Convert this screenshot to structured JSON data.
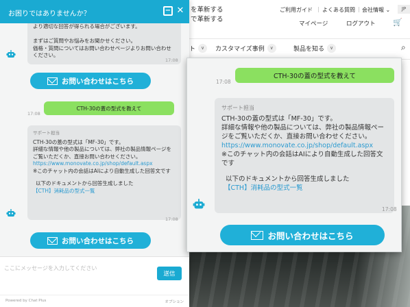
{
  "site": {
    "tagline_line1": "を革新する",
    "tagline_line2": "で革新する",
    "util_links": [
      "ご利用ガイド",
      "よくある質問",
      "会社情報 ⌄"
    ],
    "lang": "JP",
    "sub_links": [
      "マイページ",
      "ログアウト"
    ],
    "cart_icon": "cart-icon",
    "nav_items": [
      "ト",
      "カスタマイズ事例",
      "製品を知る"
    ],
    "search_icon": "search-icon"
  },
  "chat": {
    "title": "お困りではありませんか？",
    "minimize_icon": "minimize-icon",
    "close_icon": "close-icon",
    "bot_message_1": {
      "text": "より適切な回答が得られる場合がございます。\n\nまずはご質問やお悩みをお聞かせください。\n価格・質問についてはお問い合わせページよりお問い合わせください。",
      "time": "17:08"
    },
    "contact_button_label": "お問い合わせはこちら",
    "user_message": {
      "text": "CTH-30の蓋の型式を教えて",
      "time": "17:08"
    },
    "bot_message_2": {
      "sender": "サポート担当",
      "text_before_link": "CTH-30の蓋の型式は「MF-30」です。\n詳細な情報や他の製品については、弊社の製品情報ページをご覧いただくか、直接お問い合わせください。",
      "link": "https://www.monovate.co.jp/shop/default.aspx",
      "text_after_link": "※このチャット内の会話はAIにより自動生成した回答文です",
      "doc_intro": "以下のドキュメントから回答生成しました",
      "doc_link": "【CTH】消耗品の型式一覧",
      "time": "17:08"
    },
    "input_placeholder": "ここにメッセージを入力してください",
    "send_label": "送信",
    "powered_by": "Powered by Chat Plus",
    "option_label": "オプション"
  },
  "zoom": {
    "user_message": {
      "text": "CTH-30の蓋の型式を教えて",
      "time": "17:08"
    },
    "bot_message": {
      "sender": "サポート担当",
      "text_before_link": "CTH-30の蓋の型式は「MF-30」です。\n詳細な情報や他の製品については、弊社の製品情報ページをご覧いただくか、直接お問い合わせください。",
      "link": "https://www.monovate.co.jp/shop/default.aspx",
      "text_after_link": "※このチャット内の会話はAIにより自動生成した回答文です",
      "doc_intro": "以下のドキュメントから回答生成しました",
      "doc_link": "【CTH】消耗品の型式一覧",
      "time": "17:08"
    },
    "contact_button_label": "お問い合わせはこちら"
  },
  "colors": {
    "accent": "#1aaad2",
    "user_bubble": "#8be060",
    "bot_bubble": "#e3e5e6",
    "link": "#2a9ad0"
  },
  "icons": {
    "bot_avatar": "robot-icon",
    "mail": "mail-icon"
  }
}
